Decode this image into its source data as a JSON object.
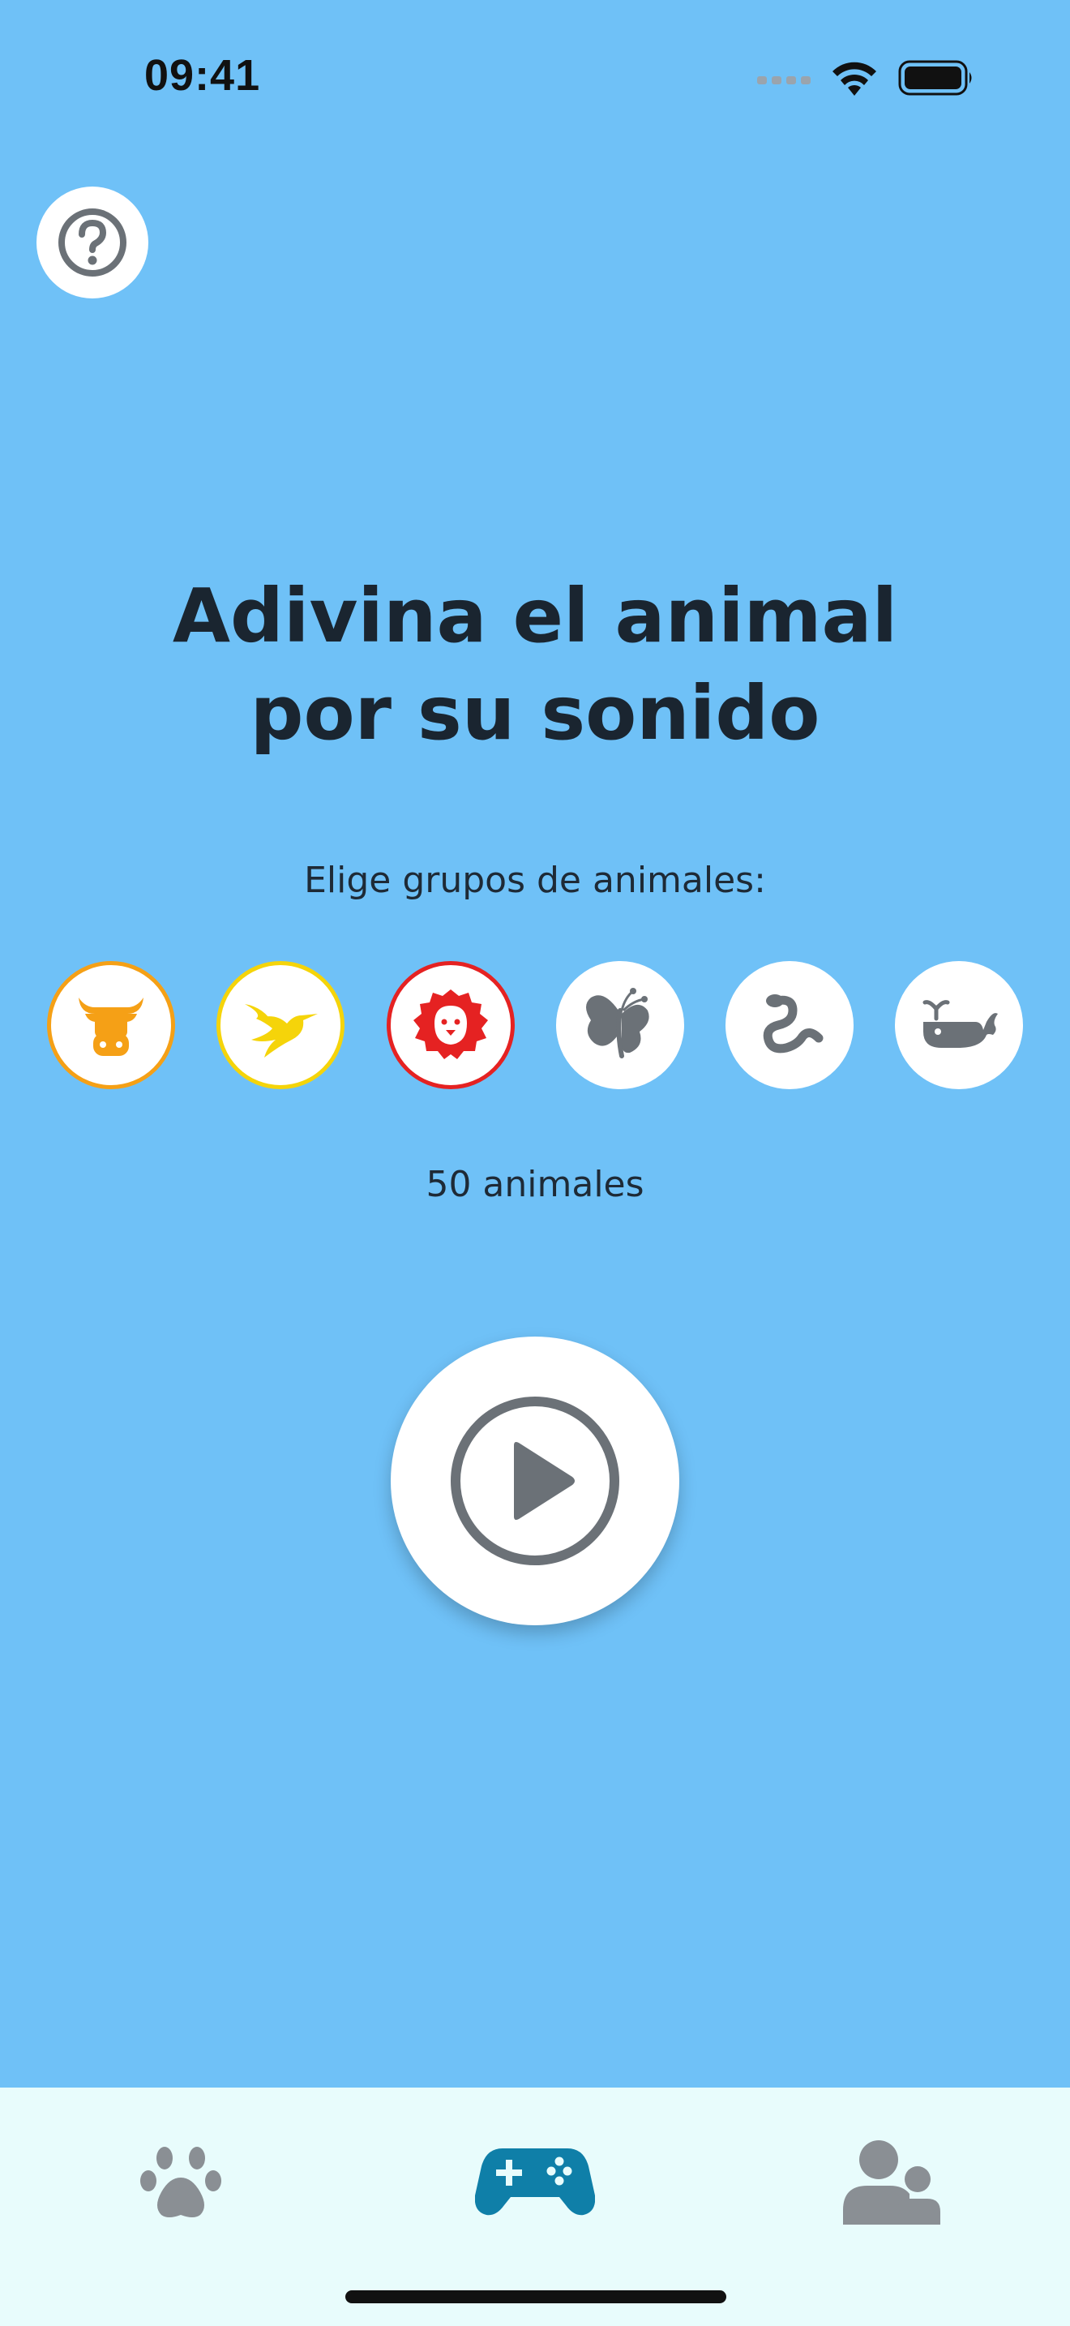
{
  "status_bar": {
    "time": "09:41",
    "icons": [
      "cellular-signal-icon",
      "wifi-icon",
      "battery-icon"
    ]
  },
  "help_button": {
    "icon": "question-circle-icon"
  },
  "title": {
    "line1": "Adivina el animal",
    "line2": "por su sonido"
  },
  "subtitle": "Elige grupos de animales:",
  "animal_groups": [
    {
      "icon": "cow-icon",
      "selected": true,
      "color": "#F5A016"
    },
    {
      "icon": "bird-icon",
      "selected": true,
      "color": "#F5D40A"
    },
    {
      "icon": "lion-icon",
      "selected": true,
      "color": "#E52222"
    },
    {
      "icon": "butterfly-icon",
      "selected": false,
      "color": "#6B7177"
    },
    {
      "icon": "snake-icon",
      "selected": false,
      "color": "#6B7177"
    },
    {
      "icon": "whale-icon",
      "selected": false,
      "color": "#6B7177"
    }
  ],
  "count_label": "50 animales",
  "play_button": {
    "icon": "play-circle-icon"
  },
  "tab_bar": {
    "tabs": [
      {
        "icon": "paw-icon",
        "active": false
      },
      {
        "icon": "gamepad-icon",
        "active": true
      },
      {
        "icon": "users-icon",
        "active": false
      }
    ]
  },
  "colors": {
    "background": "#6FC1F7",
    "tab_bar": "#E8FCFC",
    "active_tab": "#0F7FA8",
    "inactive_tab": "#8A8F94",
    "icon_gray": "#6B7177"
  }
}
